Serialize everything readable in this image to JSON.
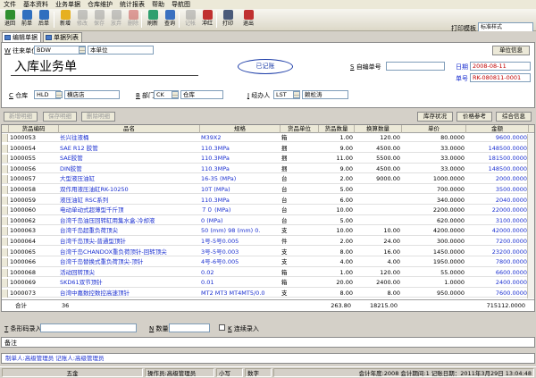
{
  "menubar": [
    "文件",
    "基本资料",
    "业务单据",
    "仓库维护",
    "统计报表",
    "帮助",
    "导航图"
  ],
  "toolbar": {
    "buttons": [
      {
        "label": "退回",
        "icon": "back-icon",
        "enabled": true
      },
      {
        "label": "前单",
        "icon": "prev-doc-icon",
        "enabled": true
      },
      {
        "label": "后单",
        "icon": "next-doc-icon",
        "enabled": true
      },
      {
        "label": "新增",
        "icon": "new-icon",
        "enabled": true
      },
      {
        "label": "修改",
        "icon": "edit-icon",
        "enabled": false
      },
      {
        "label": "保存",
        "icon": "save-icon",
        "enabled": false
      },
      {
        "label": "放弃",
        "icon": "discard-icon",
        "enabled": false
      },
      {
        "label": "删除",
        "icon": "delete-icon",
        "enabled": false
      },
      {
        "label": "刷新",
        "icon": "refresh-icon",
        "enabled": true
      },
      {
        "label": "查询",
        "icon": "search-icon",
        "enabled": true
      },
      {
        "label": "记帐",
        "icon": "post-icon",
        "enabled": false
      },
      {
        "label": "冲红",
        "icon": "reverse-icon",
        "enabled": true
      },
      {
        "label": "打印",
        "icon": "print-icon",
        "enabled": true
      },
      {
        "label": "退出",
        "icon": "exit-icon",
        "enabled": true
      }
    ],
    "print_template_label": "打印模板",
    "print_template_value": "标准样式",
    "colors": {
      "back-icon": "#2f8f2f",
      "prev-doc-icon": "#2f6fbf",
      "next-doc-icon": "#2f6fbf",
      "new-icon": "#e6b020",
      "edit-icon": "#8a8a8a",
      "save-icon": "#8a8a8a",
      "discard-icon": "#8a8a8a",
      "delete-icon": "#c03030",
      "refresh-icon": "#2f9f6f",
      "search-icon": "#3a70c0",
      "post-icon": "#8a8a8a",
      "reverse-icon": "#c03030",
      "print-icon": "#4a5a7a",
      "exit-icon": "#c03030"
    }
  },
  "tabs": [
    {
      "label": "编辑单据",
      "active": true
    },
    {
      "label": "单据列表",
      "active": false
    }
  ],
  "form": {
    "title": "入库业务单",
    "status_stamp": "已记账",
    "supplier_label": "往来单位",
    "supplier_code": "BDW",
    "supplier_name": "本单位",
    "unit_info_button": "单位信息",
    "custom_no_label": "自编单号",
    "custom_no_value": "",
    "date_label": "日期",
    "date_value": "2008-08-11",
    "doc_no_label": "单号",
    "doc_no_value": "RK-080811-0001",
    "warehouse_label": "仓库",
    "warehouse_code": "HLD",
    "warehouse_name": "横店店",
    "dept_label": "部门",
    "dept_code": "CK",
    "dept_name": "仓库",
    "handler_label": "经办人",
    "handler_code": "LST",
    "handler_name": "赖松涛",
    "shortcuts": {
      "supplier": "W",
      "custom_no": "S",
      "warehouse": "C",
      "dept": "B",
      "handler": "J"
    }
  },
  "detail_buttons": {
    "add": "新增明细",
    "save": "保存明细",
    "delete": "删除明细",
    "stock_status": "库存状况",
    "price_ref": "价格参考",
    "summary": "综合信息"
  },
  "grid": {
    "columns": [
      "货品编码",
      "品名",
      "规格",
      "货品单位",
      "货品数量",
      "换算数量",
      "单价",
      "金额"
    ],
    "rows": [
      [
        "1000053",
        "长兴往液桶",
        "M39X2",
        "箱",
        "1.00",
        "120.00",
        "80.0000",
        "9600.0000"
      ],
      [
        "1000054",
        "SAE R12 胶管",
        "110.3MPa",
        "捆",
        "9.00",
        "4500.00",
        "33.0000",
        "148500.0000"
      ],
      [
        "1000055",
        "SAE胶管",
        "110.3MPa",
        "捆",
        "11.00",
        "5500.00",
        "33.0000",
        "181500.0000"
      ],
      [
        "1000056",
        "DIN胶管",
        "110.3MPa",
        "捆",
        "9.00",
        "4500.00",
        "33.0000",
        "148500.0000"
      ],
      [
        "1000057",
        "大型液压油缸",
        "16-35 (MPa)",
        "台",
        "2.00",
        "9000.00",
        "1000.0000",
        "2000.0000"
      ],
      [
        "1000058",
        "双作用液压油缸RK-10250",
        "10T (MPa)",
        "台",
        "5.00",
        "700.0000",
        "3500.0000"
      ],
      [
        "1000059",
        "液压油缸 RSC系列",
        "110.3MPa",
        "台",
        "6.00",
        "340.0000",
        "2040.0000"
      ],
      [
        "1000060",
        "电动单动式超薄型千斤顶",
        "７０ (MPa)",
        "台",
        "10.00",
        "2200.0000",
        "22000.0000"
      ],
      [
        "1000062",
        "台湾千岛油压回转缸用集水盒-冷却液",
        "0 (MPa)",
        "台",
        "5.00",
        "620.0000",
        "3100.0000"
      ],
      [
        "1000063",
        "台湾千岛超重负荷顶尖",
        "50 (mm) 98 (mm) 0.",
        "支",
        "10.00",
        "10.00",
        "4200.0000",
        "42000.0000"
      ],
      [
        "1000064",
        "台湾千岛顶尖-普通型顶针",
        "1号-5号0.005",
        "件",
        "2.00",
        "24.00",
        "300.0000",
        "7200.0000"
      ],
      [
        "1000065",
        "台湾千岛CHANDOX重负荷顶针-回转顶尖",
        "3号-5号0.003",
        "支",
        "8.00",
        "16.00",
        "1450.0000",
        "23200.0000"
      ],
      [
        "1000066",
        "台湾千岛替换式重负荷顶尖-顶针",
        "4号-6号0.005",
        "支",
        "4.00",
        "4.00",
        "1950.0000",
        "7800.0000"
      ],
      [
        "1000068",
        "活动回转顶尖",
        "0.02",
        "箱",
        "1.00",
        "120.00",
        "55.0000",
        "6600.0000"
      ],
      [
        "1000069",
        "SKD61双节顶针",
        "0.01",
        "箱",
        "20.00",
        "2400.00",
        "1.0000",
        "2400.0000"
      ],
      [
        "1000073",
        "台湾中嘉数控数控高速顶针",
        "MT2 MT3 MT4MT5/0.0",
        "支",
        "8.00",
        "8.00",
        "950.0000",
        "7600.0000"
      ]
    ],
    "totals": {
      "label": "合计",
      "count": "36",
      "qty": "263.80",
      "converted": "18215.00",
      "amount": "715112.0000"
    }
  },
  "entry": {
    "barcode_label": "条形码录入",
    "qty_label": "数量",
    "continuous_label": "连续录入",
    "shortcuts": {
      "barcode": "T",
      "qty": "N",
      "continuous": "K"
    }
  },
  "remark": {
    "label": "备注"
  },
  "maker_text": "制单人:高级管理员   记账人:高级管理员",
  "statusbar": {
    "company": "五金",
    "operator": "操作员:高级管理员",
    "caps": "小写",
    "numlock": "数字",
    "period": "会计年度:2008  会计期间:1  记账日期：2011年3月29日  13:04:48"
  }
}
